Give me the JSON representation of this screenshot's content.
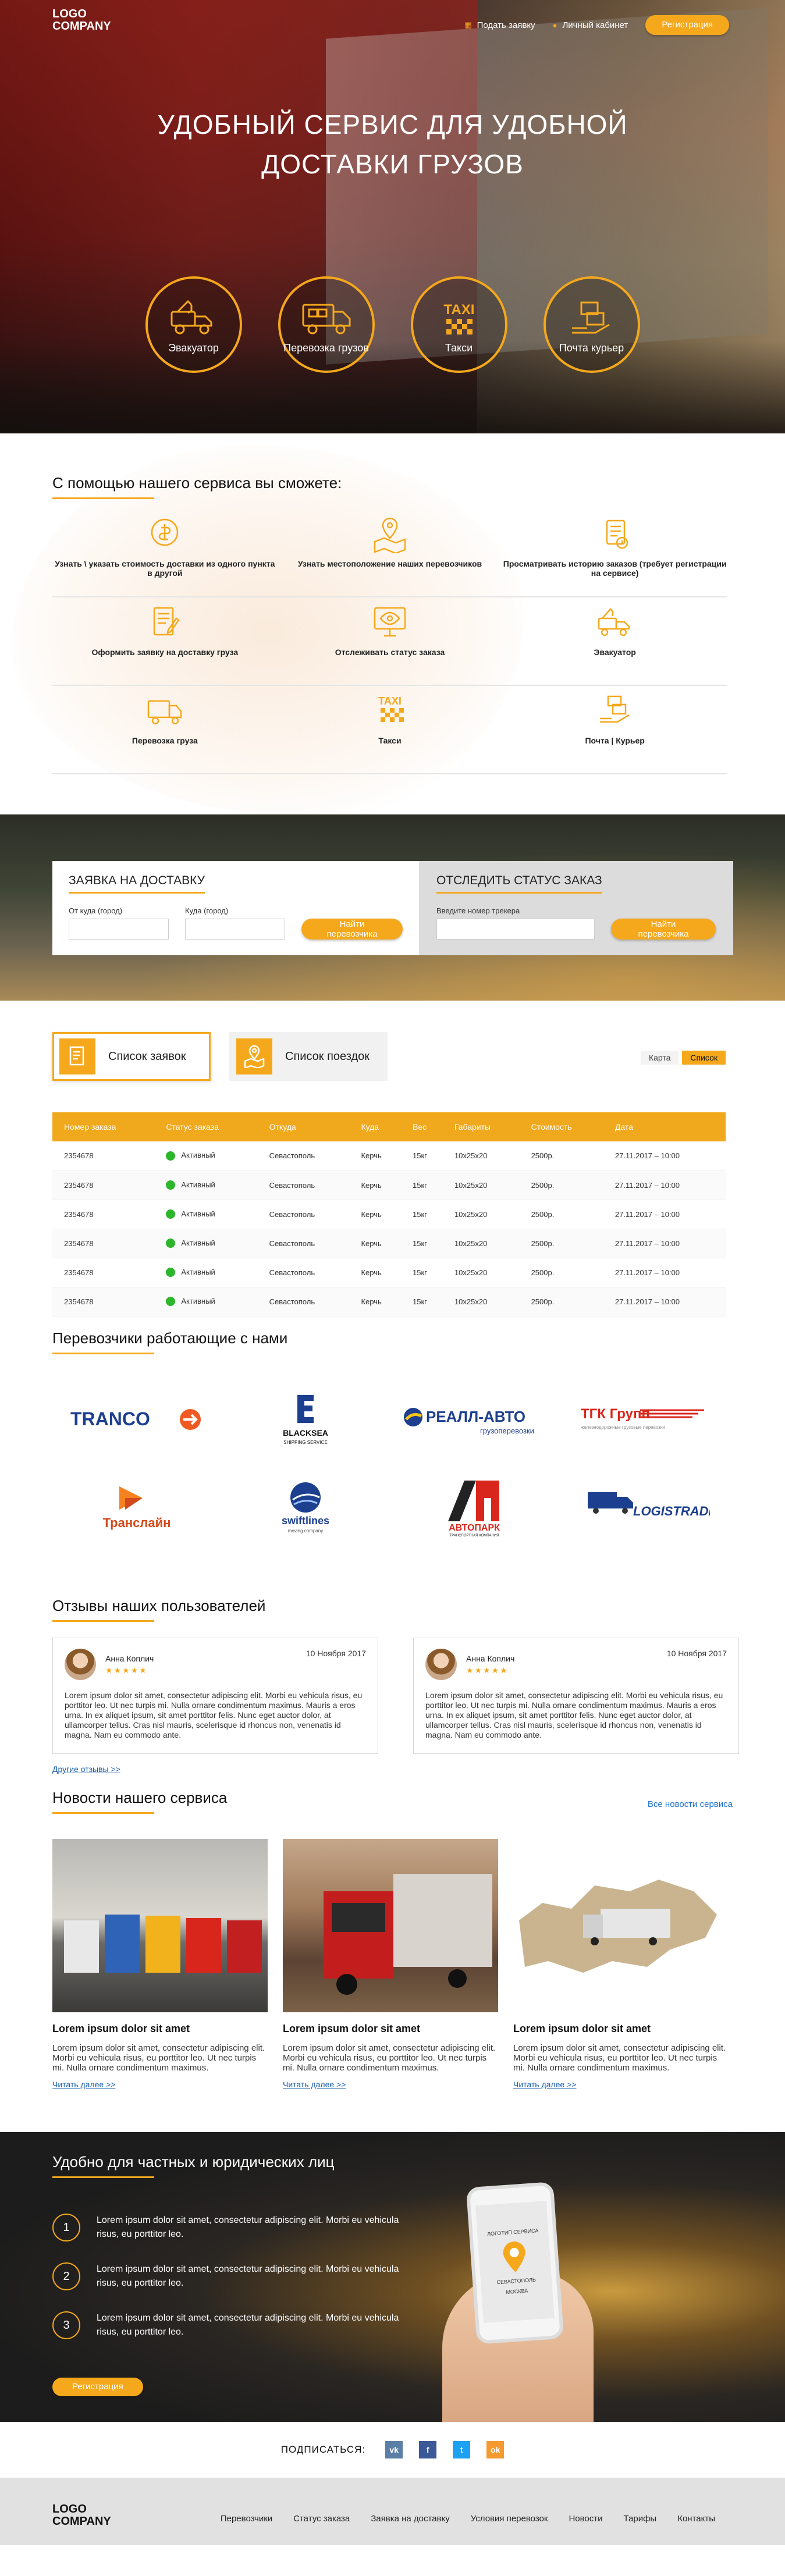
{
  "header": {
    "logo": "LOGO\nCOMPANY",
    "logo_line1": "LOGO",
    "logo_line2": "COMPANY",
    "submit_request": "Подать заявку",
    "account": "Личный кабинет",
    "register": "Регистрация"
  },
  "hero": {
    "title_line1": "УДОБНЫЙ СЕРВИС ДЛЯ УДОБНОЙ",
    "title_line2": "ДОСТАВКИ ГРУЗОВ",
    "services": [
      {
        "label": "Эвакуатор",
        "icon": "tow-truck-icon"
      },
      {
        "label": "Перевозка грузов",
        "icon": "cargo-truck-icon"
      },
      {
        "label": "Такси",
        "icon": "taxi-icon"
      },
      {
        "label": "Почта курьер",
        "icon": "courier-icon"
      }
    ]
  },
  "features": {
    "title": "С помощью нашего сервиса вы сможете:",
    "items": [
      {
        "label": "Узнать \\ указать стоимость доставки из одного пункта в другой",
        "icon": "money-icon"
      },
      {
        "label": "Узнать местоположение наших перевозчиков",
        "icon": "location-map-icon"
      },
      {
        "label": "Просматривать историю заказов (требует регистрации на сервисе)",
        "icon": "history-icon"
      },
      {
        "label": "Оформить заявку на доставку груза",
        "icon": "form-icon"
      },
      {
        "label": "Отслеживать статус заказа",
        "icon": "monitor-eye-icon"
      },
      {
        "label": "Эвакуатор",
        "icon": "tow-truck-icon"
      },
      {
        "label": "Перевозка груза",
        "icon": "truck-icon"
      },
      {
        "label": "Такси",
        "icon": "taxi-icon"
      },
      {
        "label": "Почта | Курьер",
        "icon": "courier-icon"
      }
    ]
  },
  "order_form": {
    "title": "ЗАЯВКА НА ДОСТАВКУ",
    "from_label": "От куда (город)",
    "to_label": "Куда (город)",
    "find_button": "Найти перевозчика",
    "track_title": "ОТСЛЕДИТЬ СТАТУС ЗАКАЗ",
    "track_label": "Введите номер трекера",
    "track_button": "Найти перевозчика"
  },
  "orders": {
    "tab_requests": "Список заявок",
    "tab_trips": "Список поездок",
    "view_map": "Карта",
    "view_list": "Список",
    "columns": [
      "Номер заказа",
      "Статус заказа",
      "Откуда",
      "Куда",
      "Вес",
      "Габариты",
      "Стоимость",
      "Дата"
    ],
    "rows": [
      [
        "2354678",
        "Активный",
        "Севастополь",
        "Керчь",
        "15кг",
        "10х25х20",
        "2500р.",
        "27.11.2017 – 10:00"
      ],
      [
        "2354678",
        "Активный",
        "Севастополь",
        "Керчь",
        "15кг",
        "10х25х20",
        "2500р.",
        "27.11.2017 – 10:00"
      ],
      [
        "2354678",
        "Активный",
        "Севастополь",
        "Керчь",
        "15кг",
        "10х25х20",
        "2500р.",
        "27.11.2017 – 10:00"
      ],
      [
        "2354678",
        "Активный",
        "Севастополь",
        "Керчь",
        "15кг",
        "10х25х20",
        "2500р.",
        "27.11.2017 – 10:00"
      ],
      [
        "2354678",
        "Активный",
        "Севастополь",
        "Керчь",
        "15кг",
        "10х25х20",
        "2500р.",
        "27.11.2017 – 10:00"
      ],
      [
        "2354678",
        "Активный",
        "Севастополь",
        "Керчь",
        "15кг",
        "10х25х20",
        "2500р.",
        "27.11.2017 – 10:00"
      ]
    ],
    "status_color": "#2cb62c"
  },
  "carriers": {
    "title": "Перевозчики работающие с нами",
    "logos": [
      "TRANCO",
      "BLACKSEA",
      "РЕАЛЛ-АВТО",
      "ТГК Групп",
      "Транслайн",
      "swiftlines",
      "АВТОПАРК",
      "LOGISTRADE"
    ],
    "blacksea_sub": "SHIPPING SERVICE",
    "reall_sub": "грузоперевозки",
    "tgk_sub": "железнодорожные грузовые перевозки",
    "swift_sub": "moving company",
    "autopark_sub": "ТРАНСПОРТНАЯ КОМПАНИЯ"
  },
  "reviews": {
    "title": "Отзывы наших пользователей",
    "items": [
      {
        "name": "Анна Коплич",
        "date": "10 Ноября 2017",
        "stars": "★★★★★",
        "text": "Lorem ipsum dolor sit amet, consectetur adipiscing elit. Morbi eu vehicula risus, eu porttitor leo. Ut nec turpis mi. Nulla ornare condimentum maximus. Mauris a eros urna. In ex aliquet ipsum, sit amet porttitor felis. Nunc eget auctor dolor, at ullamcorper tellus. Cras nisl mauris, scelerisque id rhoncus non, venenatis id magna. Nam eu commodo ante."
      },
      {
        "name": "Анна Коплич",
        "date": "10 Ноября 2017",
        "stars": "★★★★★",
        "text": "Lorem ipsum dolor sit amet, consectetur adipiscing elit. Morbi eu vehicula risus, eu porttitor leo. Ut nec turpis mi. Nulla ornare condimentum maximus. Mauris a eros urna. In ex aliquet ipsum, sit amet porttitor felis. Nunc eget auctor dolor, at ullamcorper tellus. Cras nisl mauris, scelerisque id rhoncus non, venenatis id magna. Nam eu commodo ante."
      }
    ],
    "more": "Другие отзывы >>"
  },
  "news": {
    "title": "Новости нашего сервиса",
    "all": "Все новости сервиса",
    "items": [
      {
        "title": "Lorem ipsum dolor sit amet",
        "text": "Lorem ipsum dolor sit amet, consectetur adipiscing elit. Morbi eu vehicula risus, eu porttitor leo. Ut nec turpis mi. Nulla ornare condimentum maximus.",
        "more": "Читать далее >>"
      },
      {
        "title": "Lorem ipsum dolor sit amet",
        "text": "Lorem ipsum dolor sit amet, consectetur adipiscing elit. Morbi eu vehicula risus, eu porttitor leo. Ut nec turpis mi. Nulla ornare condimentum maximus.",
        "more": "Читать далее >>"
      },
      {
        "title": "Lorem ipsum dolor sit amet",
        "text": "Lorem ipsum dolor sit amet, consectetur adipiscing elit. Morbi eu vehicula risus, eu porttitor leo. Ut nec turpis mi. Nulla ornare condimentum maximus.",
        "more": "Читать далее >>"
      }
    ]
  },
  "benefits": {
    "title": "Удобно для частных и юридических лиц",
    "items": [
      {
        "num": "1",
        "text": "Lorem ipsum dolor sit amet, consectetur adipiscing elit. Morbi eu vehicula risus, eu porttitor leo."
      },
      {
        "num": "2",
        "text": "Lorem ipsum dolor sit amet, consectetur adipiscing elit. Morbi eu vehicula risus, eu porttitor leo."
      },
      {
        "num": "3",
        "text": "Lorem ipsum dolor sit amet, consectetur adipiscing elit. Morbi eu vehicula risus, eu porttitor leo."
      }
    ],
    "register": "Регистрация",
    "phone_top": "ЛОГОТИП СЕРВИСА",
    "phone_city1": "СЕВАСТОПОЛЬ",
    "phone_city2": "МОСКВА"
  },
  "subscribe": {
    "label": "ПОДПИСАТЬСЯ:",
    "networks": [
      {
        "name": "vk",
        "glyph": "vk",
        "color": "#5b7fa6"
      },
      {
        "name": "facebook",
        "glyph": "f",
        "color": "#3b5998"
      },
      {
        "name": "twitter",
        "glyph": "t",
        "color": "#1da1f2"
      },
      {
        "name": "odnoklassniki",
        "glyph": "ok",
        "color": "#f59a2e"
      }
    ]
  },
  "footer": {
    "logo_line1": "LOGO",
    "logo_line2": "COMPANY",
    "nav": [
      "Перевозчики",
      "Статус заказа",
      "Заявка на доставку",
      "Условия перевозок",
      "Новости",
      "Тарифы",
      "Контакты"
    ]
  },
  "colors": {
    "accent": "#f5a81c",
    "link": "#1a5faa",
    "active": "#2cb62c"
  }
}
